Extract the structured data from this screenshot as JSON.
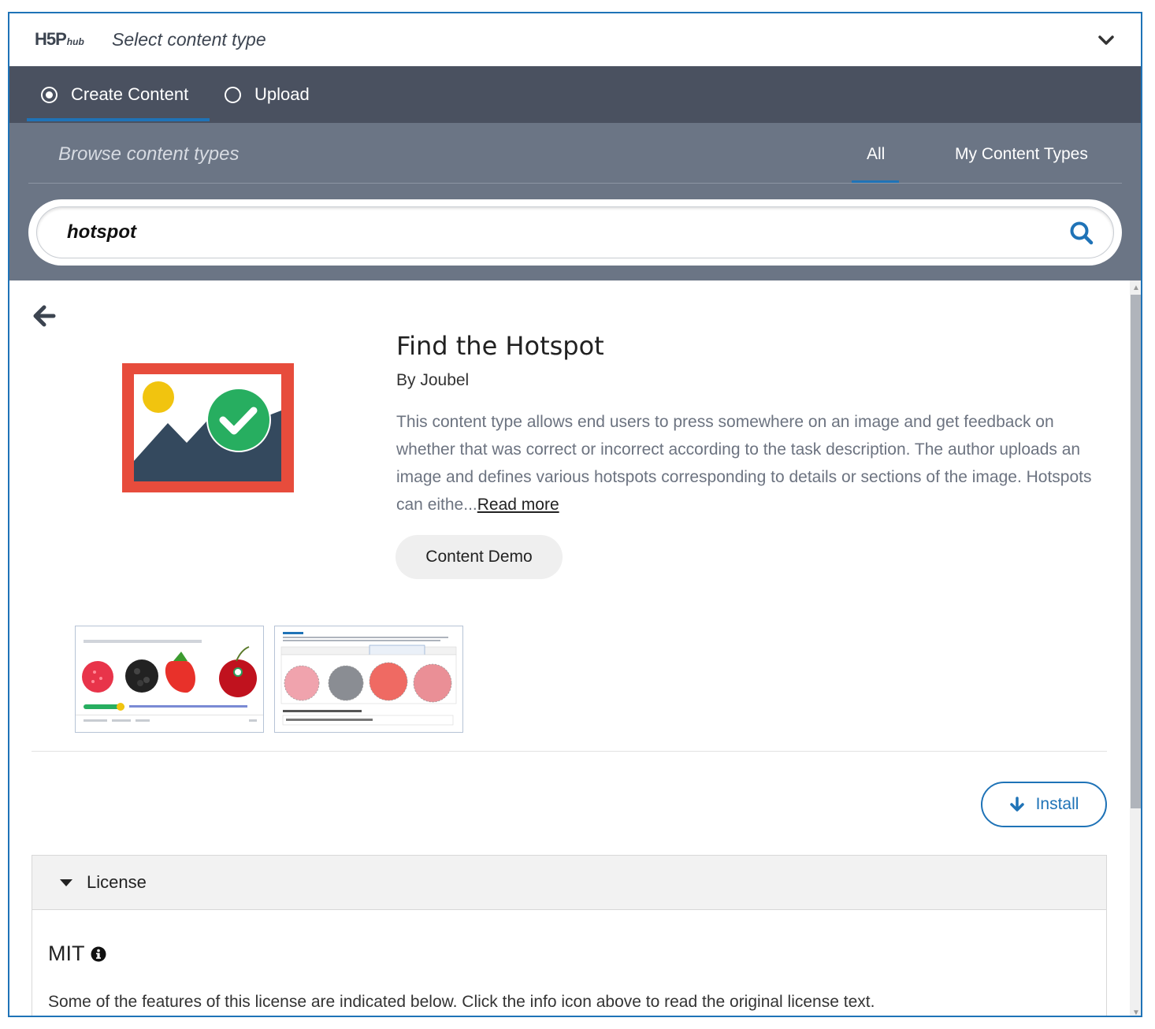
{
  "header": {
    "logo_main": "H5P",
    "logo_sub": "hub",
    "title": "Select content type"
  },
  "tabs": [
    {
      "label": "Create Content",
      "selected": true
    },
    {
      "label": "Upload",
      "selected": false
    }
  ],
  "browse": {
    "title": "Browse content types",
    "filters": [
      {
        "label": "All",
        "active": true
      },
      {
        "label": "My Content Types",
        "active": false
      }
    ]
  },
  "search": {
    "value": "hotspot"
  },
  "detail": {
    "title": "Find the Hotspot",
    "author": "By Joubel",
    "description": "This content type allows end users to press somewhere on an image and get feedback on whether that was correct or incorrect according to the task description. The author uploads an image and defines various hotspots corresponding to details or sections of the image. Hotspots can eithe...",
    "read_more": "Read more",
    "demo_button": "Content Demo",
    "install_button": "Install"
  },
  "license": {
    "header": "License",
    "name": "MIT",
    "text": "Some of the features of this license are indicated below. Click the info icon above to read the original license text."
  },
  "colors": {
    "accent": "#1f73b7",
    "tabbar": "#4a5160",
    "browse": "#6b7585",
    "icon_frame": "#e74c3c",
    "icon_check": "#27ae60"
  }
}
